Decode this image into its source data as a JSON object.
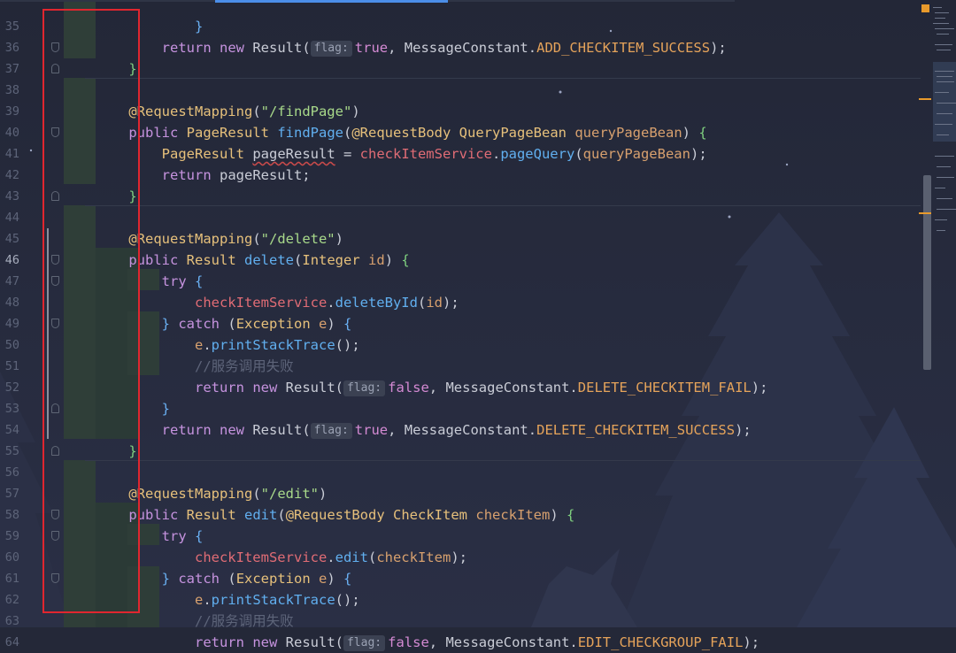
{
  "editor": {
    "lines": [
      {
        "n": "35",
        "tokens": [
          {
            "t": "            ",
            "c": "punc"
          },
          {
            "t": "}",
            "c": "brace-b"
          }
        ]
      },
      {
        "n": "36",
        "tokens": [
          {
            "t": "        "
          },
          {
            "t": "return",
            "c": "kw"
          },
          {
            "t": " "
          },
          {
            "t": "new",
            "c": "kw"
          },
          {
            "t": " Result("
          },
          {
            "hint": "flag:"
          },
          {
            "t": "true",
            "c": "bool"
          },
          {
            "t": ", MessageConstant."
          },
          {
            "t": "ADD_CHECKITEM_SUCCESS",
            "c": "const"
          },
          {
            "t": ");"
          }
        ]
      },
      {
        "n": "37",
        "tokens": [
          {
            "t": "    "
          },
          {
            "t": "}",
            "c": "brace"
          }
        ]
      },
      {
        "n": "38",
        "tokens": []
      },
      {
        "n": "39",
        "tokens": [
          {
            "t": "    "
          },
          {
            "t": "@RequestMapping",
            "c": "ann"
          },
          {
            "t": "("
          },
          {
            "t": "\"/findPage\"",
            "c": "str"
          },
          {
            "t": ")"
          }
        ]
      },
      {
        "n": "40",
        "tokens": [
          {
            "t": "    "
          },
          {
            "t": "public",
            "c": "kw"
          },
          {
            "t": " "
          },
          {
            "t": "PageResult",
            "c": "ty"
          },
          {
            "t": " "
          },
          {
            "t": "findPage",
            "c": "fn"
          },
          {
            "t": "("
          },
          {
            "t": "@RequestBody",
            "c": "ann"
          },
          {
            "t": " "
          },
          {
            "t": "QueryPageBean",
            "c": "ty"
          },
          {
            "t": " "
          },
          {
            "t": "queryPageBean",
            "c": "param"
          },
          {
            "t": ") "
          },
          {
            "t": "{",
            "c": "brace"
          }
        ]
      },
      {
        "n": "41",
        "tokens": [
          {
            "t": "        "
          },
          {
            "t": "PageResult",
            "c": "ty"
          },
          {
            "t": " "
          },
          {
            "t": "pageResult",
            "c": "under"
          },
          {
            "t": " = "
          },
          {
            "t": "checkItemService",
            "c": "fld"
          },
          {
            "t": "."
          },
          {
            "t": "pageQuery",
            "c": "fn"
          },
          {
            "t": "("
          },
          {
            "t": "queryPageBean",
            "c": "param"
          },
          {
            "t": ");"
          }
        ]
      },
      {
        "n": "42",
        "tokens": [
          {
            "t": "        "
          },
          {
            "t": "return",
            "c": "kw"
          },
          {
            "t": " pageResult;"
          }
        ]
      },
      {
        "n": "43",
        "tokens": [
          {
            "t": "    "
          },
          {
            "t": "}",
            "c": "brace"
          }
        ]
      },
      {
        "n": "44",
        "tokens": []
      },
      {
        "n": "45",
        "tokens": [
          {
            "t": "    "
          },
          {
            "t": "@RequestMapping",
            "c": "ann"
          },
          {
            "t": "("
          },
          {
            "t": "\"/delete\"",
            "c": "str"
          },
          {
            "t": ")"
          }
        ]
      },
      {
        "n": "46",
        "current": true,
        "tokens": [
          {
            "t": "    "
          },
          {
            "t": "public",
            "c": "kw"
          },
          {
            "t": " "
          },
          {
            "t": "Result",
            "c": "ty"
          },
          {
            "t": " "
          },
          {
            "t": "delete",
            "c": "fn"
          },
          {
            "t": "("
          },
          {
            "t": "Integer",
            "c": "ty"
          },
          {
            "t": " "
          },
          {
            "t": "id",
            "c": "param"
          },
          {
            "t": ") "
          },
          {
            "t": "{",
            "c": "brace"
          }
        ]
      },
      {
        "n": "47",
        "tokens": [
          {
            "t": "        "
          },
          {
            "t": "try",
            "c": "kw"
          },
          {
            "t": " "
          },
          {
            "t": "{",
            "c": "brace-b"
          }
        ]
      },
      {
        "n": "48",
        "tokens": [
          {
            "t": "            "
          },
          {
            "t": "checkItemService",
            "c": "fld"
          },
          {
            "t": "."
          },
          {
            "t": "deleteById",
            "c": "fn"
          },
          {
            "t": "("
          },
          {
            "t": "id",
            "c": "param"
          },
          {
            "t": ");"
          }
        ]
      },
      {
        "n": "49",
        "tokens": [
          {
            "t": "        "
          },
          {
            "t": "}",
            "c": "brace-b"
          },
          {
            "t": " "
          },
          {
            "t": "catch",
            "c": "kw"
          },
          {
            "t": " ("
          },
          {
            "t": "Exception",
            "c": "ty"
          },
          {
            "t": " "
          },
          {
            "t": "e",
            "c": "param"
          },
          {
            "t": ") "
          },
          {
            "t": "{",
            "c": "brace-b"
          }
        ]
      },
      {
        "n": "50",
        "tokens": [
          {
            "t": "            "
          },
          {
            "t": "e",
            "c": "param"
          },
          {
            "t": "."
          },
          {
            "t": "printStackTrace",
            "c": "fn"
          },
          {
            "t": "();"
          }
        ]
      },
      {
        "n": "51",
        "tokens": [
          {
            "t": "            "
          },
          {
            "t": "//服务调用失败",
            "c": "cmt"
          }
        ]
      },
      {
        "n": "52",
        "tokens": [
          {
            "t": "            "
          },
          {
            "t": "return",
            "c": "kw"
          },
          {
            "t": " "
          },
          {
            "t": "new",
            "c": "kw"
          },
          {
            "t": " Result("
          },
          {
            "hint": "flag:"
          },
          {
            "t": "false",
            "c": "bool"
          },
          {
            "t": ", MessageConstant."
          },
          {
            "t": "DELETE_CHECKITEM_FAIL",
            "c": "const"
          },
          {
            "t": ");"
          }
        ]
      },
      {
        "n": "53",
        "tokens": [
          {
            "t": "        "
          },
          {
            "t": "}",
            "c": "brace-b"
          }
        ]
      },
      {
        "n": "54",
        "tokens": [
          {
            "t": "        "
          },
          {
            "t": "return",
            "c": "kw"
          },
          {
            "t": " "
          },
          {
            "t": "new",
            "c": "kw"
          },
          {
            "t": " Result("
          },
          {
            "hint": "flag:"
          },
          {
            "t": "true",
            "c": "bool"
          },
          {
            "t": ", MessageConstant."
          },
          {
            "t": "DELETE_CHECKITEM_SUCCESS",
            "c": "const"
          },
          {
            "t": ");"
          }
        ]
      },
      {
        "n": "55",
        "tokens": [
          {
            "t": "    "
          },
          {
            "t": "}",
            "c": "brace"
          }
        ]
      },
      {
        "n": "56",
        "tokens": []
      },
      {
        "n": "57",
        "tokens": [
          {
            "t": "    "
          },
          {
            "t": "@RequestMapping",
            "c": "ann"
          },
          {
            "t": "("
          },
          {
            "t": "\"/edit\"",
            "c": "str"
          },
          {
            "t": ")"
          }
        ]
      },
      {
        "n": "58",
        "tokens": [
          {
            "t": "    "
          },
          {
            "t": "public",
            "c": "kw"
          },
          {
            "t": " "
          },
          {
            "t": "Result",
            "c": "ty"
          },
          {
            "t": " "
          },
          {
            "t": "edit",
            "c": "fn"
          },
          {
            "t": "("
          },
          {
            "t": "@RequestBody",
            "c": "ann"
          },
          {
            "t": " "
          },
          {
            "t": "CheckItem",
            "c": "ty"
          },
          {
            "t": " "
          },
          {
            "t": "checkItem",
            "c": "param"
          },
          {
            "t": ") "
          },
          {
            "t": "{",
            "c": "brace"
          }
        ]
      },
      {
        "n": "59",
        "tokens": [
          {
            "t": "        "
          },
          {
            "t": "try",
            "c": "kw"
          },
          {
            "t": " "
          },
          {
            "t": "{",
            "c": "brace-b"
          }
        ]
      },
      {
        "n": "60",
        "tokens": [
          {
            "t": "            "
          },
          {
            "t": "checkItemService",
            "c": "fld"
          },
          {
            "t": "."
          },
          {
            "t": "edit",
            "c": "fn"
          },
          {
            "t": "("
          },
          {
            "t": "checkItem",
            "c": "param"
          },
          {
            "t": ");"
          }
        ]
      },
      {
        "n": "61",
        "tokens": [
          {
            "t": "        "
          },
          {
            "t": "}",
            "c": "brace-b"
          },
          {
            "t": " "
          },
          {
            "t": "catch",
            "c": "kw"
          },
          {
            "t": " ("
          },
          {
            "t": "Exception",
            "c": "ty"
          },
          {
            "t": " "
          },
          {
            "t": "e",
            "c": "param"
          },
          {
            "t": ") "
          },
          {
            "t": "{",
            "c": "brace-b"
          }
        ]
      },
      {
        "n": "62",
        "tokens": [
          {
            "t": "            "
          },
          {
            "t": "e",
            "c": "param"
          },
          {
            "t": "."
          },
          {
            "t": "printStackTrace",
            "c": "fn"
          },
          {
            "t": "();"
          }
        ]
      },
      {
        "n": "63",
        "tokens": [
          {
            "t": "            "
          },
          {
            "t": "//服务调用失败",
            "c": "cmt"
          }
        ]
      },
      {
        "n": "64",
        "tokens": [
          {
            "t": "            "
          },
          {
            "t": "return",
            "c": "kw"
          },
          {
            "t": " "
          },
          {
            "t": "new",
            "c": "kw"
          },
          {
            "t": " Result("
          },
          {
            "hint": "flag:"
          },
          {
            "t": "false",
            "c": "bool"
          },
          {
            "t": ", MessageConstant."
          },
          {
            "t": "EDIT_CHECKGROUP_FAIL",
            "c": "const"
          },
          {
            "t": ");"
          }
        ]
      }
    ],
    "fold_lines": [
      "36",
      "37",
      "40",
      "43",
      "46",
      "47",
      "49",
      "53",
      "55",
      "58",
      "59",
      "61"
    ],
    "separator_after": [
      "38",
      "44",
      "56"
    ]
  },
  "colors": {
    "background": "#242838",
    "highlight_box": "#e0262f",
    "accent_tab": "#4b8ee8",
    "warning": "#e89a2c"
  }
}
